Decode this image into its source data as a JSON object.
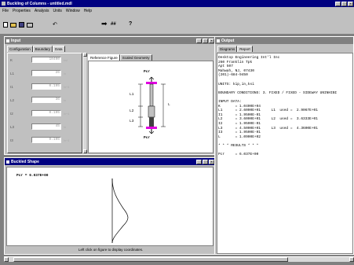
{
  "app": {
    "title": "Buckling of Columns - untitled.mdl"
  },
  "menu": [
    "File",
    "Properties",
    "Analysis",
    "Units",
    "Window",
    "Help"
  ],
  "toolbar": {
    "hash": "##",
    "question": "?"
  },
  "input": {
    "title": "Input",
    "tabs": [
      "Configuration",
      "Boundary",
      "Data"
    ],
    "fields": [
      {
        "label": "K",
        "value": "10400",
        "unit": "ksi"
      },
      {
        "label": "L1",
        "value": "26",
        "unit": "in"
      },
      {
        "label": "I1",
        "value": "0.195",
        "unit": "in^4"
      },
      {
        "label": "L2",
        "value": "36",
        "unit": "in"
      },
      {
        "label": "I2",
        "value": "0.195",
        "unit": "in^4"
      },
      {
        "label": "L3",
        "value": "45",
        "unit": "in"
      },
      {
        "label": "I3",
        "value": "0.195",
        "unit": "in^4"
      }
    ],
    "figtabs": [
      "Reference Figure",
      "Scaled Geometry"
    ],
    "fig": {
      "pcr_top": "Pcr",
      "pcr_bot": "Pcr",
      "l1": "L1",
      "l2": "L2",
      "l3": "L3",
      "l": "L"
    }
  },
  "buckled": {
    "title": "Buckled Shape",
    "pcr": "Pcr = 6.037E+00",
    "hint": "Left click on figure to display coordinates."
  },
  "output": {
    "title": "Output",
    "tabs": [
      "Diagrams",
      "Report"
    ],
    "report": "Desktop Engineering Int'l Inc\n260 Franklin Tpk\nApt 507\nMahwah, NJ, 07430\n(201)-684-9450\n\nUNITS: kip,in,ksi\n\nBOUNDARY CONDITIONS: 3. FIXED / FIXED - SIDEWAY UNINHIBI\n\nINPUT DATA:\nK       = 1.0400E+04\nL1      = 2.6000E+01     L1  used =  2.9067E+01\nI1      = 1.9500E-01\nL2      = 3.6000E+01     L2  used =  3.6333E+01\nI2      = 1.9500E-01\nL3      = 4.5000E+01     L3  used =  4.3600E+01\nI3      = 1.9500E-01\nL       = 1.0900E+02\n\n* * * RESULTS * * *\n\nPcr     = 6.037E+00"
  },
  "colors": {
    "titlebar": "#000080",
    "desktop": "#808080",
    "panel": "#c0c0c0",
    "pink": "#e000e0"
  }
}
